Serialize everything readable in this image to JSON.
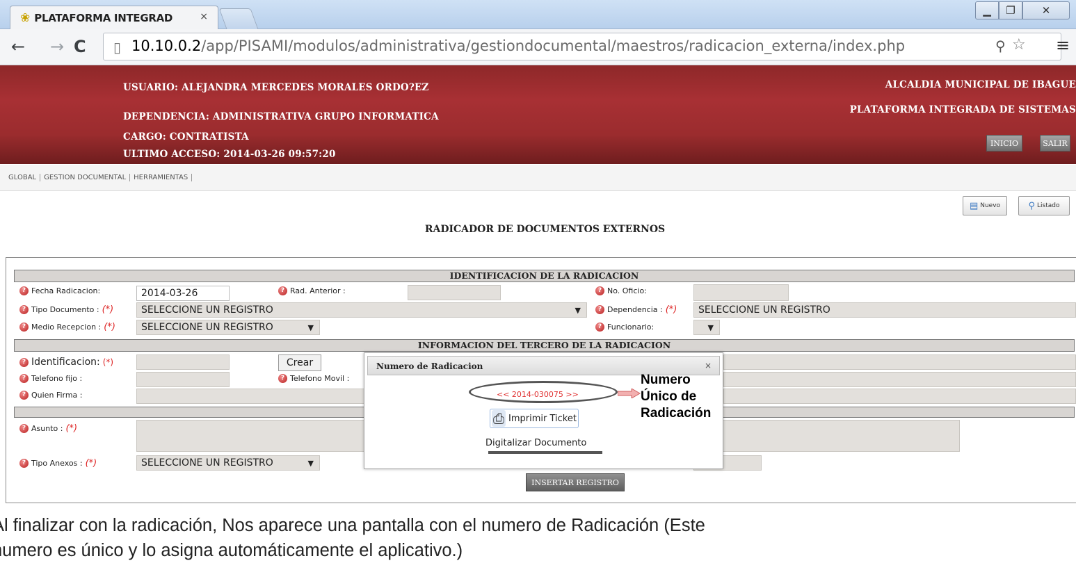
{
  "browser": {
    "tab_title": "PLATAFORMA INTEGRAD",
    "tab_close": "×",
    "url_host": "10.10.0.2",
    "url_path": "/app/PISAMI/modulos/administrativa/gestiondocumental/maestros/radicacion_externa/index.php"
  },
  "header": {
    "usuario": "USUARIO:  ALEJANDRA MERCEDES MORALES ORDO?EZ",
    "dependencia": "DEPENDENCIA:  ADMINISTRATIVA GRUPO INFORMATICA",
    "cargo": "CARGO:  CONTRATISTA",
    "ultimo_acceso": "ULTIMO ACCESO:  2014-03-26 09:57:20",
    "alcaldia": "ALCALDIA MUNICIPAL DE IBAGUE",
    "plataforma": "PLATAFORMA INTEGRADA DE SISTEMAS",
    "inicio_label": "INICIO",
    "salir_label": "SALIR"
  },
  "menu": [
    "GLOBAL",
    "GESTION DOCUMENTAL",
    "HERRAMIENTAS"
  ],
  "toolbar": {
    "nuevo_label": "Nuevo",
    "listado_label": "Listado"
  },
  "page_title": "RADICADOR DE DOCUMENTOS EXTERNOS",
  "form": {
    "section1_title": "IDENTIFICACION DE LA RADICACION",
    "fecha_label": "Fecha Radicacion:",
    "fecha_value": "2014-03-26",
    "rad_anterior_label": "Rad. Anterior :",
    "no_oficio_label": "No. Oficio:",
    "tipo_documento_label": "Tipo Documento :",
    "tipo_documento_value": "SELECCIONE UN REGISTRO",
    "dependencia_label": "Dependencia :",
    "dependencia_value": "SELECCIONE UN REGISTRO",
    "medio_recepcion_label": "Medio Recepcion :",
    "medio_recepcion_value": "SELECCIONE UN REGISTRO",
    "funcionario_label": "Funcionario:",
    "section2_title": "INFORMACION DEL TERCERO DE LA RADICACION",
    "identificacion_label": "Identificacion:",
    "crear_label": "Crear",
    "telefono_fijo_label": "Telefono fijo :",
    "telefono_movil_label": "Telefono Movil :",
    "quien_firma_label": "Quien Firma :",
    "asunto_label": "Asunto :",
    "tipo_anexos_label": "Tipo Anexos :",
    "tipo_anexos_value": "SELECCIONE UN REGISTRO",
    "required_mark": "(*)",
    "insertar_label": "INSERTAR REGISTRO"
  },
  "dialog": {
    "title": "Numero de Radicacion",
    "close": "×",
    "number": "<< 2014-030075 >>",
    "print_label": "Imprimir Ticket",
    "digitalizar_label": "Digitalizar Documento"
  },
  "annotation": {
    "line1": "Numero",
    "line2": "Único de",
    "line3": "Radicación"
  },
  "caption": {
    "line1": "Al finalizar con la radicación, Nos aparece una pantalla con el numero de Radicación (Este",
    "line2": "numero es único y lo asigna automáticamente el aplicativo.)"
  },
  "colors": {
    "header_red": "#a83034",
    "required_red": "#d22222",
    "section_gray": "#d8d5d2"
  }
}
